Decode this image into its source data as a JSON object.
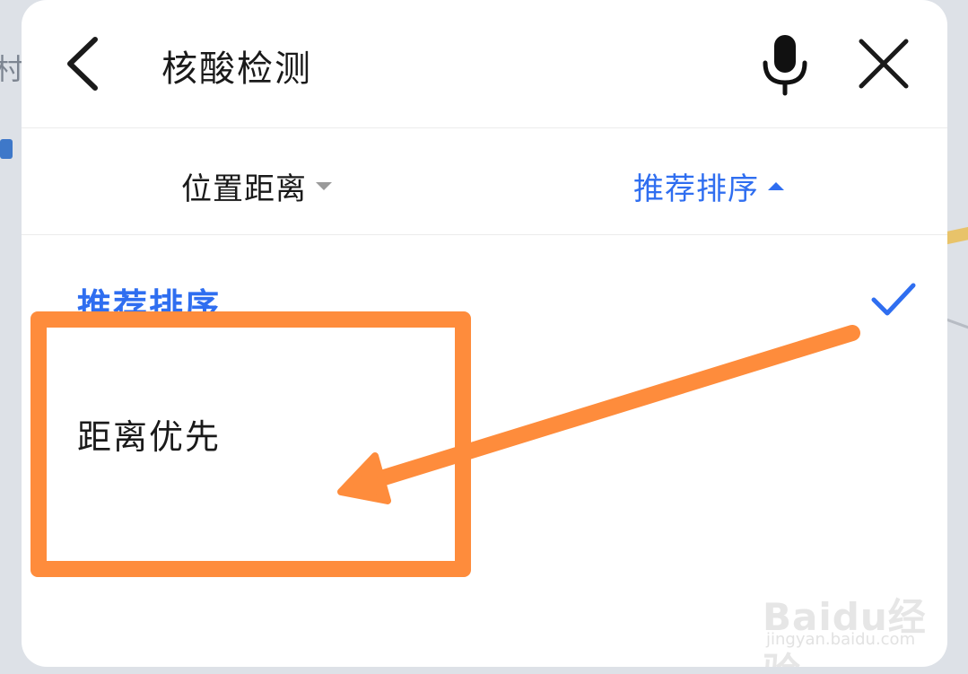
{
  "map": {
    "edge_char": "村"
  },
  "header": {
    "title": "核酸检测",
    "back_icon": "chevron-left-icon",
    "mic_icon": "microphone-icon",
    "close_icon": "close-icon"
  },
  "filters": {
    "distance_label": "位置距离",
    "sort_label": "推荐排序",
    "active_color": "#2f6ef0"
  },
  "options": [
    {
      "label": "推荐排序",
      "selected": true
    },
    {
      "label": "距离优先",
      "selected": false
    }
  ],
  "annotation": {
    "color": "#fe8c3c"
  },
  "watermark": {
    "main": "Baidu经验",
    "sub": "jingyan.baidu.com"
  }
}
